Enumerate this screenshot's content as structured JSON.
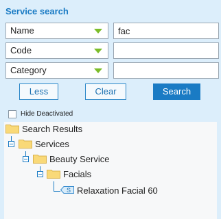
{
  "title": "Service search",
  "filters": [
    {
      "field": "Name",
      "value": "fac"
    },
    {
      "field": "Code",
      "value": ""
    },
    {
      "field": "Category",
      "value": ""
    }
  ],
  "buttons": {
    "less": "Less",
    "clear": "Clear",
    "search": "Search"
  },
  "hide_deactivated": {
    "label": "Hide Deactivated",
    "checked": false
  },
  "tree": {
    "root": "Search Results",
    "level1": "Services",
    "level2": "Beauty Service",
    "level3": "Facials",
    "leaf": "Relaxation Facial 60",
    "leaf_icon_glyph": "S"
  },
  "colors": {
    "accent": "#1a7bc4",
    "arrow": "#7cbd2a",
    "folder": "#f9d978"
  }
}
